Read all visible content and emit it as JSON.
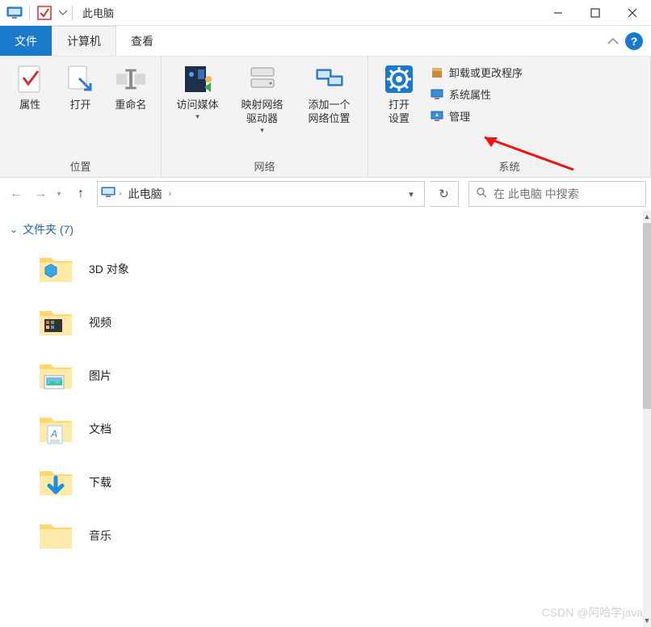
{
  "window": {
    "title": "此电脑"
  },
  "tabs": {
    "file": "文件",
    "computer": "计算机",
    "view": "查看"
  },
  "ribbon": {
    "group1": {
      "label": "位置",
      "properties": "属性",
      "open": "打开",
      "rename": "重命名"
    },
    "group2": {
      "label": "网络",
      "media": "访问媒体",
      "mapdrive": "映射网络\n驱动器",
      "addloc": "添加一个\n网络位置"
    },
    "group3": {
      "label": "系统",
      "opensettings": "打开\n设置",
      "uninstall": "卸载或更改程序",
      "sysprops": "系统属性",
      "manage": "管理"
    }
  },
  "nav": {
    "crumb": "此电脑",
    "search_placeholder": "在 此电脑 中搜索"
  },
  "section": {
    "title": "文件夹 (7)"
  },
  "folders": {
    "f0": "3D 对象",
    "f1": "视频",
    "f2": "图片",
    "f3": "文档",
    "f4": "下载",
    "f5": "音乐"
  },
  "watermark": "CSDN @阿哈学java"
}
